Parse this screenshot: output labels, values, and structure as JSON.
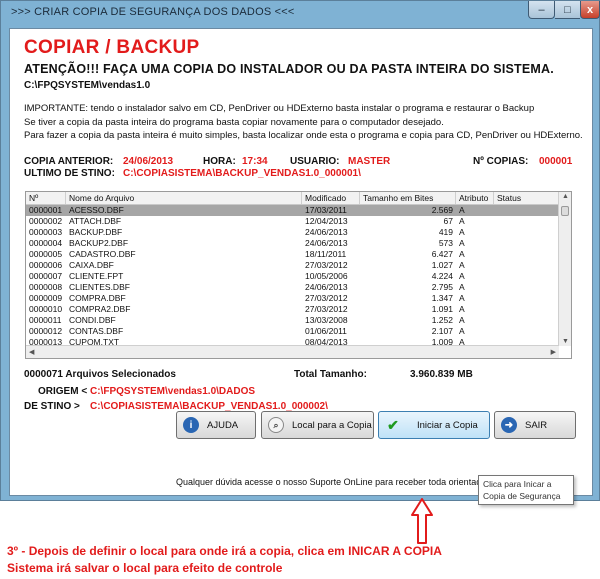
{
  "window": {
    "title": ">>> CRIAR COPIA DE SEGURANÇA DOS DADOS <<<",
    "minimize_glyph": "–",
    "maximize_glyph": "□",
    "close_glyph": "x"
  },
  "header": {
    "title": "COPIAR / BACKUP",
    "warning": "ATENÇÃO!!!   FAÇA  UMA COPIA DO INSTALADOR OU DA PASTA INTEIRA DO SISTEMA.",
    "system_path": "C:\\FPQSYSTEM\\vendas1.0"
  },
  "info_lines": [
    "IMPORTANTE: tendo o instalador salvo em CD, PenDriver ou HDExterno basta instalar o programa e restaurar o Backup",
    "Se tiver a copia da pasta inteira do programa basta copiar novamente para o computador desejado.",
    "Para fazer a copia da pasta inteira é muito simples, basta localizar onde esta o programa e copia para CD, PenDriver ou HDExterno."
  ],
  "last_copy": {
    "label": "COPIA ANTERIOR:",
    "date": "24/06/2013",
    "time_label": "HORA:",
    "time": "17:34",
    "user_label": "USUARIO:",
    "user": "MASTER",
    "count_label": "Nº COPIAS:",
    "count": "000001",
    "dest_label": "ULTIMO DE STINO:",
    "dest": "C:\\COPIASISTEMA\\BACKUP_VENDAS1.0_000001\\"
  },
  "table": {
    "columns": [
      "Nº",
      "Nome do Arquivo",
      "Modificado",
      "Tamanho em Bites",
      "Atributo",
      "Status"
    ],
    "rows": [
      [
        "0000001",
        "ACESSO.DBF",
        "17/03/2011",
        "2.569",
        "A",
        ""
      ],
      [
        "0000002",
        "ATTACH.DBF",
        "12/04/2013",
        "67",
        "A",
        ""
      ],
      [
        "0000003",
        "BACKUP.DBF",
        "24/06/2013",
        "419",
        "A",
        ""
      ],
      [
        "0000004",
        "BACKUP2.DBF",
        "24/06/2013",
        "573",
        "A",
        ""
      ],
      [
        "0000005",
        "CADASTRO.DBF",
        "18/11/2011",
        "6.427",
        "A",
        ""
      ],
      [
        "0000006",
        "CAIXA.DBF",
        "27/03/2012",
        "1.027",
        "A",
        ""
      ],
      [
        "0000007",
        "CLIENTE.FPT",
        "10/05/2006",
        "4.224",
        "A",
        ""
      ],
      [
        "0000008",
        "CLIENTES.DBF",
        "24/06/2013",
        "2.795",
        "A",
        ""
      ],
      [
        "0000009",
        "COMPRA.DBF",
        "27/03/2012",
        "1.347",
        "A",
        ""
      ],
      [
        "0000010",
        "COMPRA2.DBF",
        "27/03/2012",
        "1.091",
        "A",
        ""
      ],
      [
        "0000011",
        "CONDI.DBF",
        "13/03/2008",
        "1.252",
        "A",
        ""
      ],
      [
        "0000012",
        "CONTAS.DBF",
        "01/06/2011",
        "2.107",
        "A",
        ""
      ],
      [
        "0000013",
        "CUPOM.TXT",
        "08/04/2013",
        "1.009",
        "A",
        ""
      ]
    ]
  },
  "summary": {
    "selected": "0000071 Arquivos Selecionados",
    "total_label": "Total Tamanho:",
    "total_value": "3.960.839 MB"
  },
  "paths": {
    "origin_label": "ORIGEM  <",
    "origin": "C:\\FPQSYSTEM\\vendas1.0\\DADOS",
    "dest_label": "DE STINO >",
    "dest": "C:\\COPIASISTEMA\\BACKUP_VENDAS1.0_000002\\"
  },
  "buttons": {
    "help": "AJUDA",
    "local": "Local para a Copia",
    "start": "Iniciar a Copia",
    "exit": "SAIR"
  },
  "footer": "Qualquer dúvida acesse o nosso Suporte OnLine para receber toda orientação",
  "tooltip": {
    "line1": "Clica para Inicar a",
    "line2": "Copia de Segurança"
  },
  "annotation": {
    "line1": "3º - Depois de definir o local para onde irá a copia, clica em INICAR A COPIA",
    "line2": "Sistema irá salvar o local para efeito de controle"
  },
  "colors": {
    "accent_red": "#e21b1b",
    "window_frame": "#7fb2d4",
    "selected_row": "#a6a6a6"
  }
}
